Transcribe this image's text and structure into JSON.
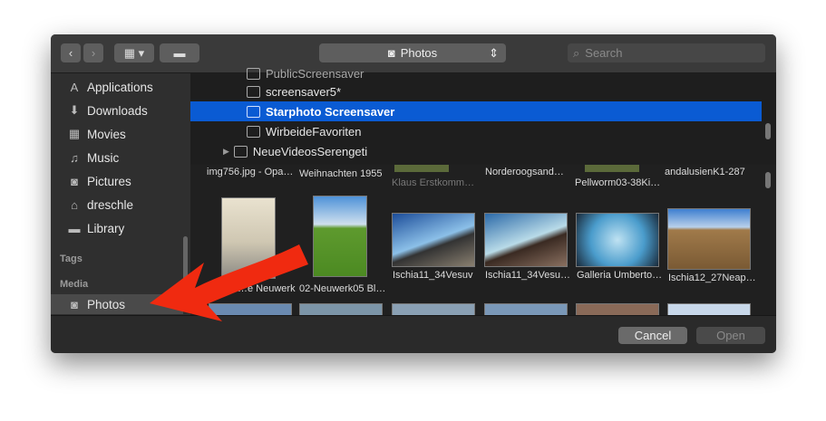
{
  "toolbar": {
    "location": "Photos",
    "search_placeholder": "Search",
    "back": "‹",
    "forward": "›",
    "view": "▦ ▾",
    "folder": "▬"
  },
  "sidebar": {
    "items": [
      {
        "label": "Applications",
        "icon": "applications-icon",
        "glyph": "A"
      },
      {
        "label": "Downloads",
        "icon": "downloads-icon",
        "glyph": "⬇"
      },
      {
        "label": "Movies",
        "icon": "movies-icon",
        "glyph": "▦"
      },
      {
        "label": "Music",
        "icon": "music-icon",
        "glyph": "♫"
      },
      {
        "label": "Pictures",
        "icon": "pictures-icon",
        "glyph": "◙"
      },
      {
        "label": "dreschle",
        "icon": "home-icon",
        "glyph": "⌂"
      },
      {
        "label": "Library",
        "icon": "folder-icon",
        "glyph": "▬"
      }
    ],
    "tags_header": "Tags",
    "media_header": "Media",
    "media_items": [
      {
        "label": "Photos",
        "icon": "camera-icon",
        "glyph": "◙"
      }
    ]
  },
  "list": {
    "rows": [
      {
        "label": "PublicScreensaver"
      },
      {
        "label": "screensaver5*"
      },
      {
        "label": "Starphoto Screensaver",
        "selected": true
      },
      {
        "label": "WirbeideFavoriten"
      },
      {
        "label": "NeueVideosSerengeti",
        "disclosure": "▶"
      }
    ]
  },
  "grid": {
    "top_row_captions": [
      "img756.jpg - Opa…",
      "Weihnachten 1955",
      "Klaus Erstkomm…",
      "Norderoogsand…",
      "Pellworm03-38Ki…",
      "andalusienK1-287"
    ],
    "photos": [
      {
        "caption": "…e Neuwerk"
      },
      {
        "caption": "02-Neuwerk05 Bl…"
      },
      {
        "caption": "Ischia11_34Vesuv"
      },
      {
        "caption": "Ischia11_34Vesu…"
      },
      {
        "caption": "Galleria Umberto…"
      },
      {
        "caption": "Ischia12_27Neap…"
      }
    ]
  },
  "footer": {
    "cancel": "Cancel",
    "open": "Open"
  },
  "colors": {
    "selection": "#0a5bd3",
    "arrow": "#f02a10"
  }
}
